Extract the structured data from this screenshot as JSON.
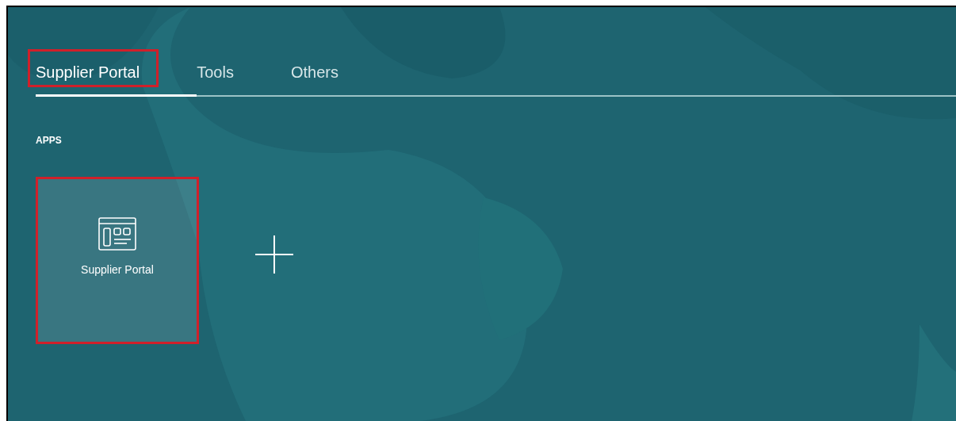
{
  "tabs": [
    {
      "label": "Supplier Portal",
      "selected": true,
      "highlighted": true
    },
    {
      "label": "Tools",
      "selected": false,
      "highlighted": false
    },
    {
      "label": "Others",
      "selected": false,
      "highlighted": false
    }
  ],
  "apps": {
    "heading": "APPS",
    "tiles": [
      {
        "kind": "app",
        "label": "Supplier Portal",
        "highlighted": true
      },
      {
        "kind": "add"
      }
    ]
  }
}
